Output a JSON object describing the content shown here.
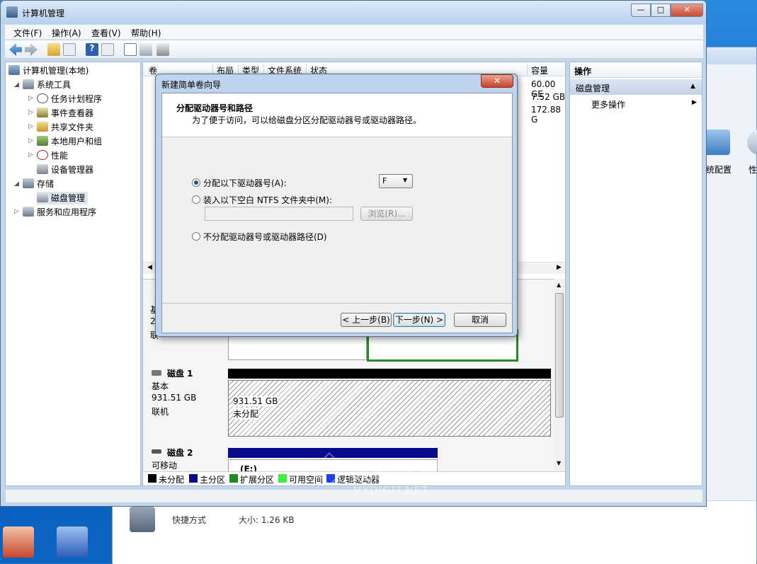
{
  "window": {
    "title": "计算机管理",
    "minimize": "—",
    "maximize": "□",
    "close": "✕"
  },
  "menu": [
    "文件(F)",
    "操作(A)",
    "查看(V)",
    "帮助(H)"
  ],
  "tree": {
    "root": "计算机管理(本地)",
    "system_tools": "系统工具",
    "task_scheduler": "任务计划程序",
    "event_viewer": "事件查看器",
    "shared_folders": "共享文件夹",
    "local_users": "本地用户和组",
    "performance": "性能",
    "device_manager": "设备管理器",
    "storage": "存储",
    "disk_management": "磁盘管理",
    "services": "服务和应用程序"
  },
  "volume_table": {
    "headers": [
      "卷",
      "布局",
      "类型",
      "文件系统",
      "状态",
      "容量"
    ],
    "capacities": [
      "60.00 GE",
      "7.52 GB",
      "172.88 G"
    ]
  },
  "disks": [
    {
      "name": "磁盘 1",
      "type": "基本",
      "size": "931.51 GB",
      "status": "联机",
      "part_size": "931.51 GB",
      "part_label": "未分配"
    },
    {
      "name": "磁盘 2",
      "type": "可移动",
      "part_label": "(E:)"
    }
  ],
  "disk0_partial": [
    "基",
    "2",
    "联"
  ],
  "legend": [
    {
      "label": "未分配",
      "color": "#000000"
    },
    {
      "label": "主分区",
      "color": "#0a0a8c"
    },
    {
      "label": "扩展分区",
      "color": "#1e8c1e"
    },
    {
      "label": "可用空间",
      "color": "#3cf03c"
    },
    {
      "label": "逻辑驱动器",
      "color": "#1e3cf0"
    }
  ],
  "actions": {
    "header": "操作",
    "section": "磁盘管理",
    "more": "更多操作"
  },
  "dialog": {
    "title": "新建简单卷向导",
    "heading": "分配驱动器号和路径",
    "subtitle": "为了便于访问，可以给磁盘分区分配驱动器号或驱动器路径。",
    "opt_assign": "分配以下驱动器号(A):",
    "opt_mount": "装入以下空白 NTFS 文件夹中(M):",
    "opt_none": "不分配驱动器号或驱动器路径(D)",
    "drive_letter": "F",
    "browse": "浏览(R)...",
    "back": "< 上一步(B)",
    "next": "下一步(N) >",
    "cancel": "取消",
    "selected_option": "assign"
  },
  "background": {
    "label1": "统配置",
    "label2": "性",
    "shortcut_type": "快捷方式",
    "shortcut_size": "大小: 1.26 KB"
  },
  "watermark": {
    "cn": "数码之家",
    "en": "MYDIGIT.NET"
  }
}
